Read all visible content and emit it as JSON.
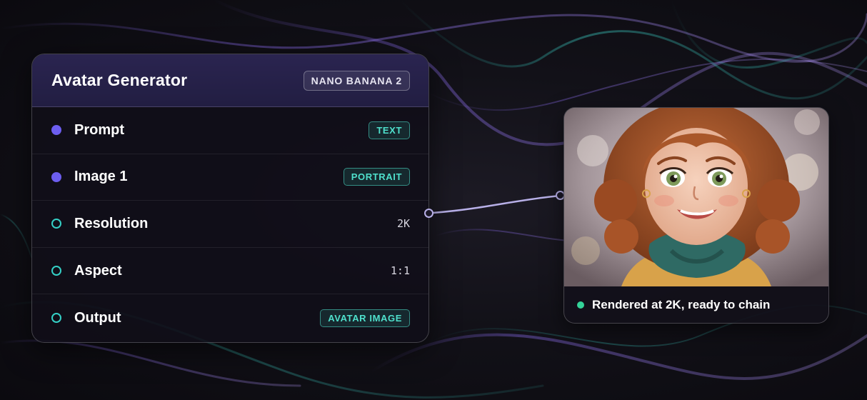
{
  "node": {
    "title": "Avatar Generator",
    "model_badge": "NANO BANANA 2",
    "rows": [
      {
        "label": "Prompt",
        "kind": "tag",
        "value": "TEXT",
        "port": "filled"
      },
      {
        "label": "Image 1",
        "kind": "tag",
        "value": "PORTRAIT",
        "port": "filled"
      },
      {
        "label": "Resolution",
        "kind": "value",
        "value": "2K",
        "port": "hollow"
      },
      {
        "label": "Aspect",
        "kind": "value",
        "value": "1:1",
        "port": "hollow"
      },
      {
        "label": "Output",
        "kind": "tag",
        "value": "AVATAR IMAGE",
        "port": "hollow"
      }
    ]
  },
  "preview": {
    "status": "Rendered at 2K, ready to chain",
    "status_color": "#34d399"
  },
  "colors": {
    "input_port": "#6d5ef0",
    "param_port": "#35d0c6",
    "tag_text": "#4fe0cc",
    "header_bg": "#2a2450"
  }
}
